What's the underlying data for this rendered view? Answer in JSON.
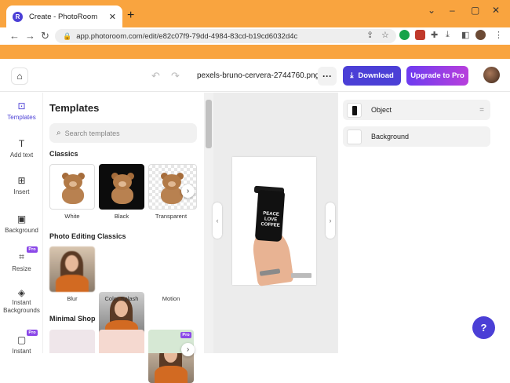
{
  "browser": {
    "tab_title": "Create - PhotoRoom",
    "tab_favicon": "photoroom-logo-icon",
    "new_tab": "+",
    "url": "app.photoroom.com/edit/e82c07f9-79dd-4984-83cd-b19cd6032d4c",
    "accent_color": "#f9a43f"
  },
  "header": {
    "filename": "pexels-bruno-cervera-2744760.png",
    "more_label": "···",
    "download_label": "Download",
    "pro_label": "Upgrade to Pro",
    "primary_color": "#4b3fd6"
  },
  "rail": {
    "items": [
      {
        "label": "Templates",
        "icon": "templates-icon"
      },
      {
        "label": "Add text",
        "icon": "text-icon"
      },
      {
        "label": "Insert",
        "icon": "insert-image-icon"
      },
      {
        "label": "Background",
        "icon": "background-icon"
      },
      {
        "label": "Resize",
        "icon": "resize-icon",
        "badge": "Pro"
      },
      {
        "label": "Instant Backgrounds",
        "icon": "instant-backgrounds-icon"
      },
      {
        "label": "Instant",
        "icon": "instant-icon",
        "badge": "Pro"
      }
    ]
  },
  "templates": {
    "title": "Templates",
    "search_placeholder": "Search templates",
    "sections": [
      {
        "title": "Classics",
        "items": [
          "White",
          "Black",
          "Transparent"
        ]
      },
      {
        "title": "Photo Editing Classics",
        "items": [
          "Blur",
          "Color Splash",
          "Motion"
        ]
      },
      {
        "title": "Minimal Shop",
        "items": [
          "",
          "",
          ""
        ]
      }
    ],
    "shop_badge": "Pro"
  },
  "canvas": {
    "cup_text": [
      "PEACE",
      "LOVE",
      "COFFEE"
    ]
  },
  "layers": {
    "items": [
      "Object",
      "Background"
    ]
  }
}
